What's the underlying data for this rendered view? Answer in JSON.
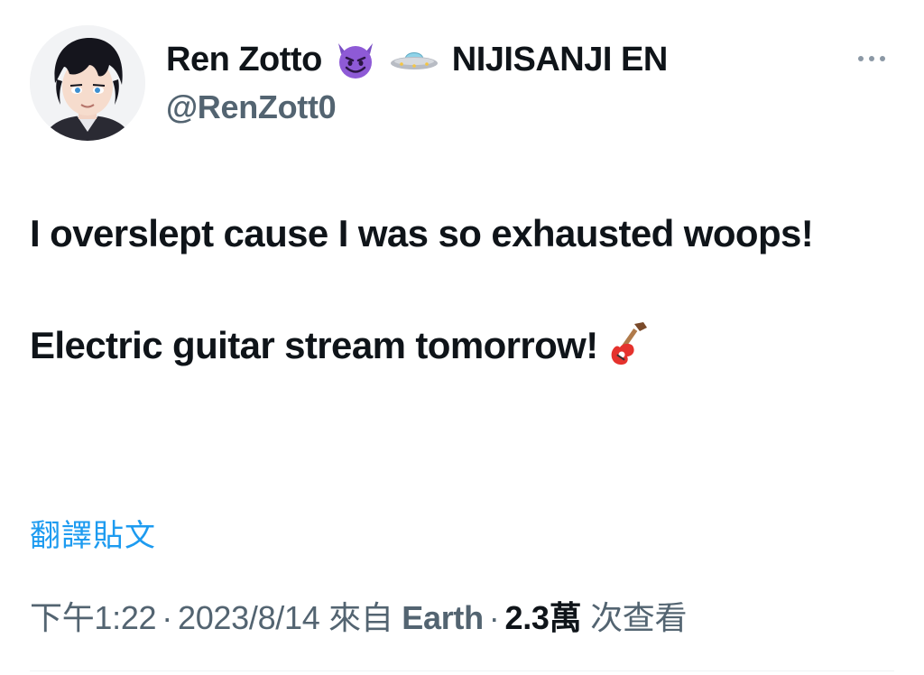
{
  "author": {
    "display_name": "Ren Zotto",
    "affiliation": "NIJISANJI EN",
    "handle": "@RenZott0",
    "name_emojis": [
      "smiling-devil-emoji",
      "flying-saucer-emoji"
    ]
  },
  "tweet": {
    "line1": "I overslept cause I was so exhausted woops!",
    "line2": "Electric guitar stream tomorrow!",
    "trailing_emoji": "guitar-emoji"
  },
  "translate_label": "翻譯貼文",
  "meta": {
    "time": "下午1:22",
    "date": "2023/8/14",
    "source_prefix": "來自",
    "source": "Earth",
    "views_number": "2.3萬",
    "views_suffix": "次查看",
    "separator": "·"
  },
  "colors": {
    "text": "#0f1419",
    "secondary": "#536471",
    "link": "#1d9bf0"
  }
}
